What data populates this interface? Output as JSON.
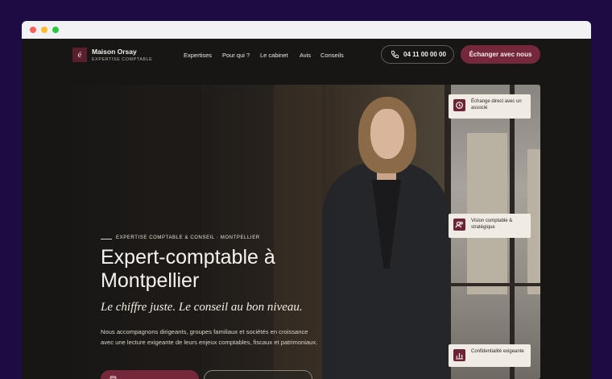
{
  "browser": {
    "controls": [
      "close",
      "minimize",
      "maximize"
    ]
  },
  "header": {
    "logo_letter": "é",
    "brand_name": "Maison Orsay",
    "brand_subtitle": "EXPERTISE COMPTABLE",
    "nav": [
      "Expertises",
      "Pour qui ?",
      "Le cabinet",
      "Avis",
      "Conseils"
    ],
    "phone": "04 11 00 00 00",
    "cta": "Échanger avec nous"
  },
  "hero": {
    "eyebrow": "EXPERTISE COMPTABLE & CONSEIL · MONTPELLIER",
    "title": "Expert-comptable à Montpellier",
    "tagline": "Le chiffre juste. Le conseil au bon niveau.",
    "description": "Nous accompagnons dirigeants, groupes familiaux et sociétés en croissance avec une lecture exigeante de leurs enjeux comptables, fiscaux et patrimoniaux.",
    "badges": [
      {
        "icon": "clock-icon",
        "text": "Échange direct avec un associé"
      },
      {
        "icon": "users-icon",
        "text": "Vision comptable & stratégique"
      },
      {
        "icon": "bar-chart-icon",
        "text": "Confidentialité exigeante"
      }
    ]
  },
  "colors": {
    "accent": "#74283a",
    "background": "#171615",
    "frame": "#1d0b43"
  }
}
